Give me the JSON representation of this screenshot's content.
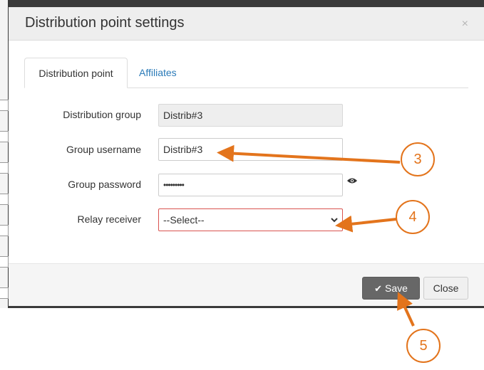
{
  "modal": {
    "title": "Distribution point settings",
    "close_glyph": "×"
  },
  "tabs": [
    {
      "label": "Distribution point",
      "active": true
    },
    {
      "label": "Affiliates",
      "active": false
    }
  ],
  "form": {
    "distribution_group": {
      "label": "Distribution group",
      "value": "Distrib#3"
    },
    "group_username": {
      "label": "Group username",
      "value": "Distrib#3"
    },
    "group_password": {
      "label": "Group password",
      "value": "•••••••••"
    },
    "relay_receiver": {
      "label": "Relay receiver",
      "value": "--Select--"
    }
  },
  "footer": {
    "save_label": "Save",
    "close_label": "Close"
  },
  "annotations": {
    "callout_3": "3",
    "callout_4": "4",
    "callout_5": "5",
    "color": "#e3741c"
  },
  "icons": {
    "save": "checkmark-icon",
    "password": "eye-icon",
    "select": "chevron-down-icon"
  }
}
